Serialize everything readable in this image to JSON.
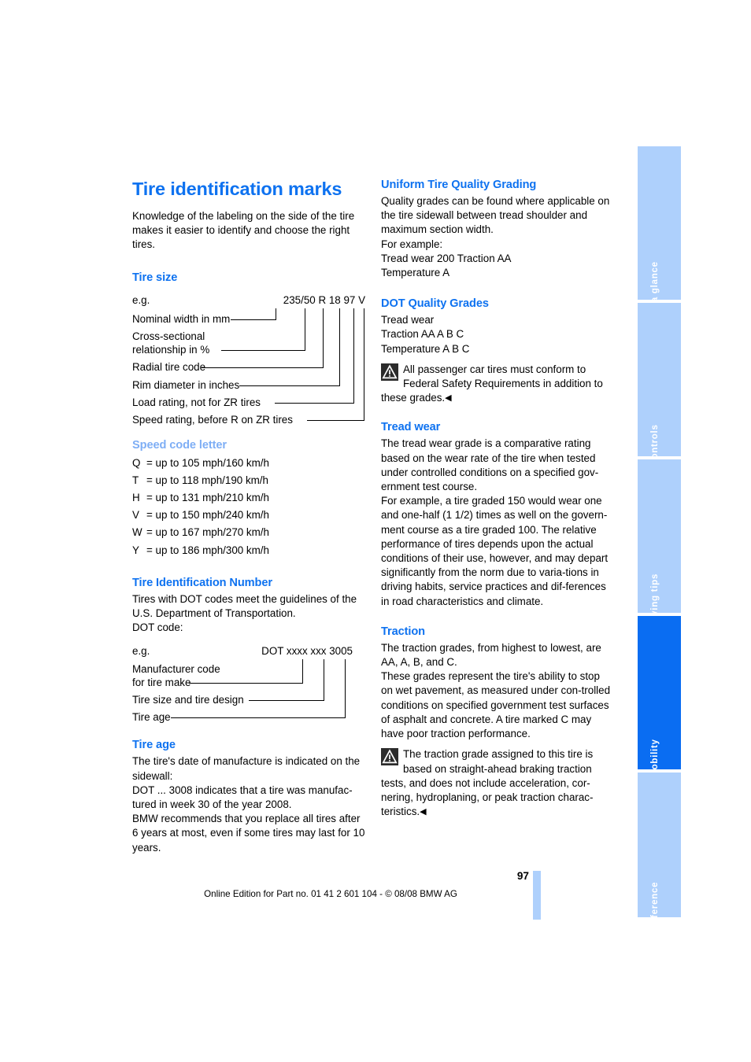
{
  "document": {
    "page_number": "97",
    "footer_text": "Online Edition for Part no. 01 41 2 601 104 - © 08/08 BMW AG"
  },
  "left_column": {
    "title": "Tire identification marks",
    "intro": "Knowledge of the labeling on the side of the tire makes it easier to identify and choose the right tires.",
    "tire_size": {
      "heading": "Tire size",
      "eg_label": "e.g.",
      "eg_code": "235/50 R 18 97 V",
      "callouts": [
        "Nominal width in mm",
        "Cross-sectional",
        "relationship in %",
        "Radial tire code",
        "Rim diameter in inches",
        "Load rating, not for ZR tires",
        "Speed rating, before R on ZR tires"
      ]
    },
    "speed_code": {
      "heading": "Speed code letter",
      "rows": [
        {
          "letter": "Q",
          "value": "= up to 105 mph/160 km/h"
        },
        {
          "letter": "T",
          "value": "= up to 118 mph/190 km/h"
        },
        {
          "letter": "H",
          "value": "= up to 131 mph/210 km/h"
        },
        {
          "letter": "V",
          "value": "= up to 150 mph/240 km/h"
        },
        {
          "letter": "W",
          "value": "= up to 167 mph/270 km/h"
        },
        {
          "letter": "Y",
          "value": "= up to 186 mph/300 km/h"
        }
      ]
    },
    "tin": {
      "heading": "Tire Identification Number",
      "body": "Tires with DOT codes meet the guidelines of the U.S. Department of Transportation.",
      "dot_code_label": "DOT code:",
      "eg_label": "e.g.",
      "eg_code": "DOT xxxx xxx 3005",
      "callouts": [
        "Manufacturer code",
        "for tire make",
        "Tire size and tire design",
        "Tire age"
      ]
    },
    "tire_age": {
      "heading": "Tire age",
      "para1": "The tire's date of manufacture is indicated on the sidewall:",
      "para2": "DOT ... 3008 indicates that a tire was manufac-tured in week 30 of the year 2008.",
      "para3": "BMW recommends that you replace all tires after 6 years at most, even if some tires may last for 10 years."
    }
  },
  "right_column": {
    "utqg": {
      "heading": "Uniform Tire Quality Grading",
      "para1": "Quality grades can be found where applicable on the tire sidewall between tread shoulder and maximum section width.",
      "para2": "For example:",
      "para3": "Tread wear 200 Traction AA",
      "para4": "Temperature A"
    },
    "dot_grades": {
      "heading": "DOT Quality Grades",
      "line1": "Tread wear",
      "line2": "Traction AA A B C",
      "line3": "Temperature A B C",
      "warning": "All passenger car tires must conform to Federal Safety Requirements in addition to these grades.",
      "endmark": "◀"
    },
    "tread_wear": {
      "heading": "Tread wear",
      "para1": "The tread wear grade is a comparative rating based on the wear rate of the tire when tested under controlled conditions on a specified gov-ernment test course.",
      "para2": "For example, a tire graded 150 would wear one and one-half (1 1/2) times as well on the govern-ment course as a tire graded 100. The relative performance of tires depends upon the actual conditions of their use, however, and may depart significantly from the norm due to varia-tions in driving habits, service practices and dif-ferences in road characteristics and climate."
    },
    "traction": {
      "heading": "Traction",
      "para1": "The traction grades, from highest to lowest, are AA, A, B, and C.",
      "para2": "These grades represent the tire's ability to stop on wet pavement, as measured under con-trolled conditions on specified government test surfaces of asphalt and concrete. A tire marked C may have poor traction performance.",
      "warning": "The traction grade assigned to this tire is based on straight-ahead braking traction tests, and does not include acceleration, cor-nering, hydroplaning, or peak traction charac-teristics.",
      "endmark": "◀"
    }
  },
  "nav_tabs": {
    "items": [
      {
        "label": "At a glance",
        "active": false
      },
      {
        "label": "Controls",
        "active": false
      },
      {
        "label": "Driving tips",
        "active": false
      },
      {
        "label": "Mobility",
        "active": true
      },
      {
        "label": "Reference",
        "active": false
      }
    ]
  },
  "colors": {
    "accent_blue": "#0e72f0",
    "light_blue": "#7eaef5",
    "tab_blue": "#aed0fc",
    "tab_active_blue": "#0a6df2"
  }
}
